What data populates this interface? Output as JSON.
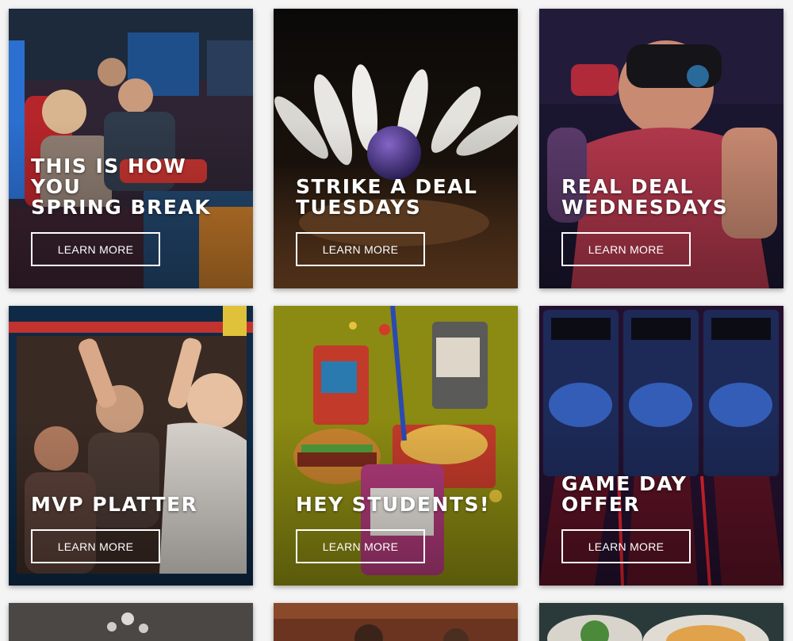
{
  "promos": [
    {
      "title": "This is how you\nspring break",
      "button": "LEARN MORE"
    },
    {
      "title": "Strike a deal\nTuesdays",
      "button": "LEARN MORE"
    },
    {
      "title": "Real Deal\nWednesdays",
      "button": "LEARN MORE"
    },
    {
      "title": "MVP Platter",
      "button": "LEARN MORE"
    },
    {
      "title": "Hey Students!",
      "button": "LEARN MORE"
    },
    {
      "title": "Game Day\nOffer",
      "button": "LEARN MORE"
    }
  ],
  "colors": {
    "arcade_bg": "#3a2b3a",
    "bowling_bg": "#0b0a0a",
    "vr_bg": "#3a1a36",
    "mvp_bg": "#0e2a46",
    "students_bg": "#8a8a10",
    "skeeball_bg": "#2b1436",
    "button_border": "#ffffff",
    "page_bg": "#f4f4f4"
  }
}
